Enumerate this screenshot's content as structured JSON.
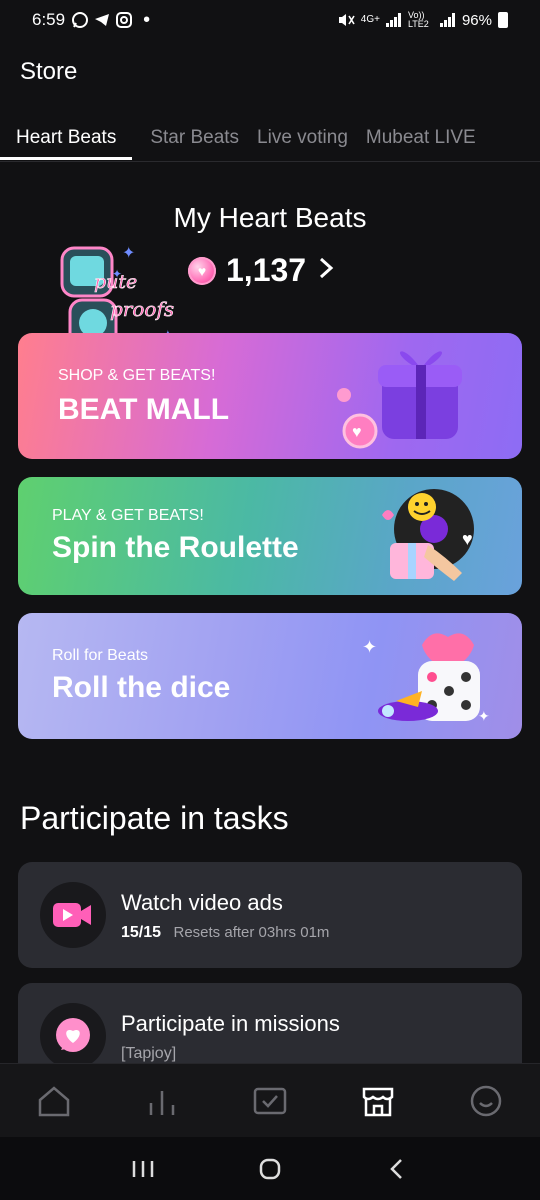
{
  "status_bar": {
    "time": "6:59",
    "battery": "96%",
    "network_label": "4G+",
    "volte_label": "Vo)) LTE2"
  },
  "app_title": "Store",
  "tabs": [
    {
      "label": "Heart Beats",
      "active": true
    },
    {
      "label": "Star Beats",
      "active": false
    },
    {
      "label": "Live voting",
      "active": false
    },
    {
      "label": "Mubeat LIVE",
      "active": false
    }
  ],
  "my_beats": {
    "title": "My Heart Beats",
    "balance": "1,137",
    "sticker_text": "pute proofs"
  },
  "banners": [
    {
      "subtitle": "SHOP & GET BEATS!",
      "title": "BEAT MALL",
      "icon": "gift-box-icon"
    },
    {
      "subtitle": "PLAY & GET BEATS!",
      "title": "Spin the Roulette",
      "icon": "roulette-icon"
    },
    {
      "subtitle": "Roll for Beats",
      "title": "Roll the dice",
      "icon": "dice-icon"
    }
  ],
  "tasks_section": {
    "title": "Participate in tasks",
    "items": [
      {
        "title": "Watch video ads",
        "count": "15/15",
        "detail": "Resets after 03hrs 01m",
        "icon": "video-camera-icon"
      },
      {
        "title": "Participate in missions",
        "count": "",
        "detail": "[Tapjoy]",
        "icon": "heart-chat-icon"
      }
    ]
  },
  "bottom_nav": [
    "home-icon",
    "chart-icon",
    "checklist-icon",
    "store-icon",
    "profile-icon"
  ],
  "colors": {
    "background": "#111113",
    "card": "#2b2c32",
    "accent_pink": "#ff68b4"
  }
}
